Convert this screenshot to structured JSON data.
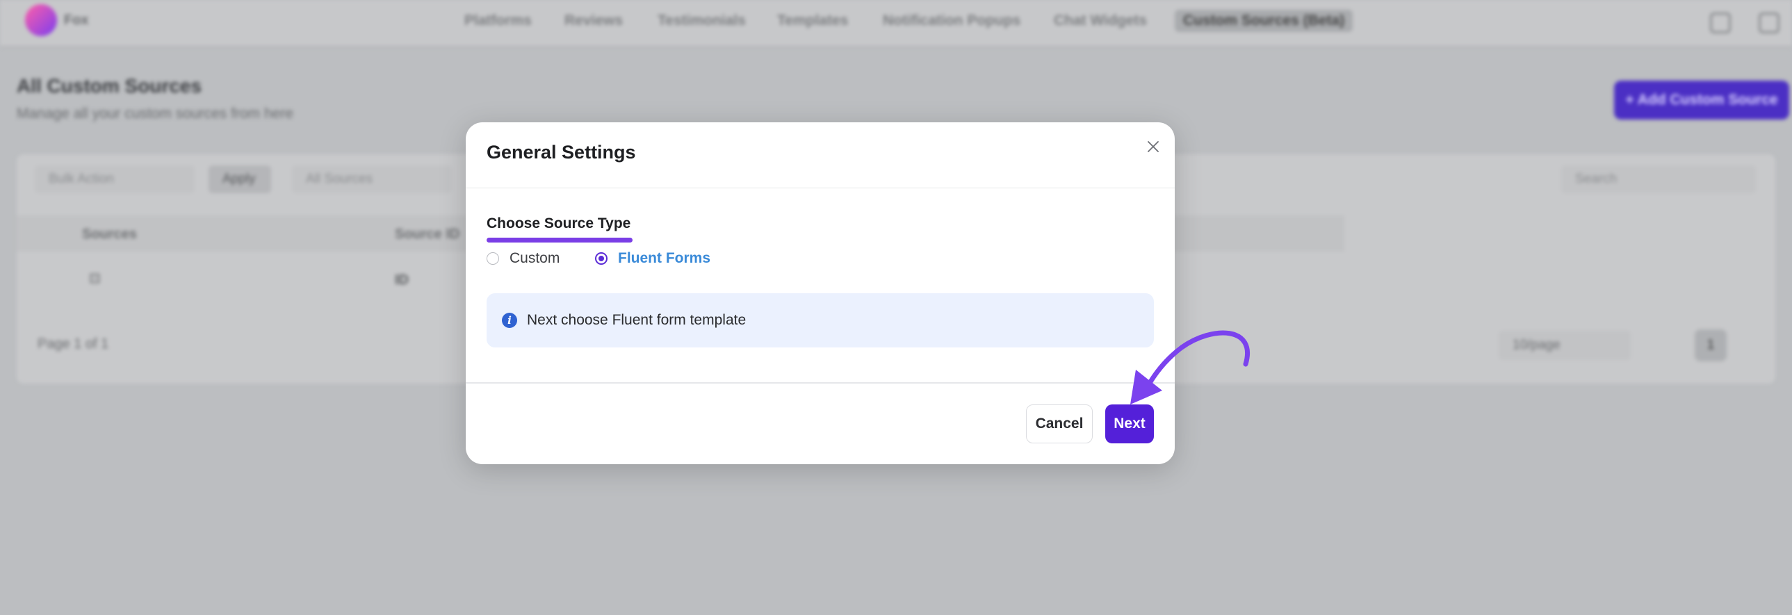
{
  "background": {
    "brand": "Fox",
    "nav": [
      "Platforms",
      "Reviews",
      "Testimonials",
      "Templates",
      "Notification Popups",
      "Chat Widgets",
      "Custom Sources (Beta)"
    ],
    "page_title": "All Custom Sources",
    "page_subtitle": "Manage all your custom sources from here",
    "add_button": "+ Add Custom Source",
    "filters": {
      "bulk": "Bulk Action",
      "apply": "Apply",
      "all_sources": "All Sources",
      "search": "Search"
    },
    "table": {
      "columns": [
        "Sources",
        "Source ID"
      ],
      "row": {
        "source": "⊡",
        "source_id": "ID"
      }
    },
    "pagination": {
      "page_text": "Page 1 of 1",
      "per_page": "10/page",
      "current": "1"
    }
  },
  "modal": {
    "title": "General Settings",
    "section_label": "Choose Source Type",
    "options": [
      {
        "label": "Custom",
        "checked": false
      },
      {
        "label": "Fluent Forms",
        "checked": true
      }
    ],
    "info_text": "Next choose Fluent form template",
    "cancel_label": "Cancel",
    "next_label": "Next"
  },
  "colors": {
    "accent": "#5420d9",
    "underline": "#7a3ee6",
    "arrow": "#7b42ee",
    "info_bg": "#ebf1fe",
    "link": "#3a8ad8"
  }
}
